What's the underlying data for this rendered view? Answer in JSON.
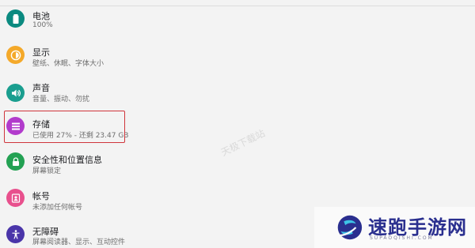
{
  "settings": {
    "items": [
      {
        "title": "电池",
        "subtitle": "100%",
        "icon": "battery-icon",
        "color": "#0b8a80"
      },
      {
        "title": "显示",
        "subtitle": "壁纸、休眠、字体大小",
        "icon": "brightness-icon",
        "color": "#f4a92a"
      },
      {
        "title": "声音",
        "subtitle": "音量、振动、勿扰",
        "icon": "volume-icon",
        "color": "#1a9e8f"
      },
      {
        "title": "存储",
        "subtitle": "已使用 27% - 还剩 23.47 GB",
        "icon": "storage-icon",
        "color": "#b23bcc"
      },
      {
        "title": "安全性和位置信息",
        "subtitle": "屏幕锁定",
        "icon": "lock-icon",
        "color": "#23a153"
      },
      {
        "title": "帐号",
        "subtitle": "未添加任何帐号",
        "icon": "account-icon",
        "color": "#e8508d"
      },
      {
        "title": "无障碍",
        "subtitle": "屏幕阅读器、显示、互动控件",
        "icon": "accessibility-icon",
        "color": "#4a35a9"
      }
    ]
  },
  "watermark": {
    "text": "天极下载站"
  },
  "brand": {
    "name": "速跑手游网",
    "url": "SUPAOQISHI.COM",
    "color": "#2a2f8f"
  }
}
